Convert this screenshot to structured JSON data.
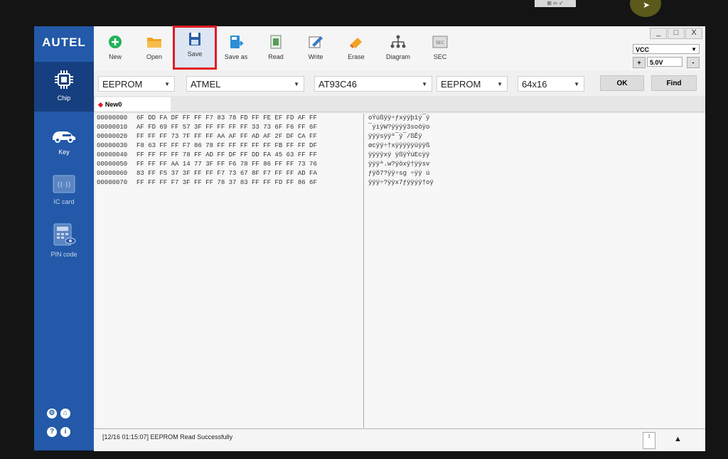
{
  "desktop": {
    "widget_text": "⊞ ═ ✓"
  },
  "app": {
    "logo": "AUTEL"
  },
  "sidebar": {
    "items": [
      {
        "label": "Chip",
        "icon": "chip-icon"
      },
      {
        "label": "Key",
        "icon": "car-key-icon"
      },
      {
        "label": "IC card",
        "icon": "ic-card-icon"
      },
      {
        "label": "PIN code",
        "icon": "pin-code-icon"
      }
    ],
    "bottom_icons": [
      "gear-icon",
      "home-icon",
      "help-icon",
      "info-icon"
    ]
  },
  "toolbar": {
    "items": [
      {
        "label": "New",
        "icon": "new-icon"
      },
      {
        "label": "Open",
        "icon": "open-folder-icon"
      },
      {
        "label": "Save",
        "icon": "save-icon",
        "highlighted": true
      },
      {
        "label": "Save as",
        "icon": "save-as-icon"
      },
      {
        "label": "Read",
        "icon": "read-icon"
      },
      {
        "label": "Write",
        "icon": "write-icon"
      },
      {
        "label": "Erase",
        "icon": "erase-icon"
      },
      {
        "label": "Diagram",
        "icon": "diagram-icon"
      },
      {
        "label": "SEC",
        "icon": "sec-icon"
      }
    ]
  },
  "window_controls": {
    "minimize": "_",
    "maximize": "□",
    "close": "X"
  },
  "voltage": {
    "selector": "VCC",
    "minus": "-",
    "plus": "+",
    "value": "5.0V"
  },
  "selectors": {
    "type": "EEPROM",
    "brand": "ATMEL",
    "model": "AT93C46",
    "mode": "EEPROM",
    "size": "64x16",
    "ok_label": "OK",
    "find_label": "Find"
  },
  "tab": {
    "label": "New0"
  },
  "hex": {
    "rows": [
      {
        "addr": "00000000",
        "bytes": "6F DD FA DF FF FF F7 83 78 FD FF FE EF FD AF FF",
        "ascii": "oÝúßÿÿ÷ƒxýÿþïý¯ÿ"
      },
      {
        "addr": "00000010",
        "bytes": "AF FD 69 FF 57 3F FF FF FF FF 33 73 6F F6 FF 6F",
        "ascii": "¯ýiÿW?ÿÿÿÿ3soöÿo"
      },
      {
        "addr": "00000020",
        "bytes": "FF FF FF 73 7F FF FF AA AF FF AD AF 2F DF CA FF",
        "ascii": "ÿÿÿsÿÿª¯ÿ¯/ßÊÿ"
      },
      {
        "addr": "00000030",
        "bytes": "F8 63 FF FF F7 86 78 FF FF FF FF FF FB FF FF DF",
        "ascii": "øcÿÿ÷†xÿÿÿÿÿûÿÿß"
      },
      {
        "addr": "00000040",
        "bytes": "FF FF FF FF 78 FF AD FF DF FF DD FA 45 63 FF FF",
        "ascii": "ÿÿÿÿxÿ ÿßÿÝúEcÿÿ"
      },
      {
        "addr": "00000050",
        "bytes": "FF FF FF AA 14 77 3F FF F6 78 FF 86 FF FF 73 76",
        "ascii": "ÿÿÿª.w?ÿöxÿ†ÿÿsv"
      },
      {
        "addr": "00000060",
        "bytes": "83 FF F5 37 3F FF FF F7 73 67 8F F7 FF FF AD FA",
        "ascii": "ƒÿõ7?ÿÿ÷sg ÷ÿÿ ú"
      },
      {
        "addr": "00000070",
        "bytes": "FF FF FF F7 3F FF FF 78 37 83 FF FF FD FF 86 6F",
        "ascii": "ÿÿÿ÷?ÿÿx7ƒÿÿýÿ†oÿ"
      }
    ]
  },
  "status": {
    "message": "[12/16 01:15:07] EEPROM Read Successfully",
    "scroll_up": "▲",
    "scroll_arrows": "↕"
  }
}
